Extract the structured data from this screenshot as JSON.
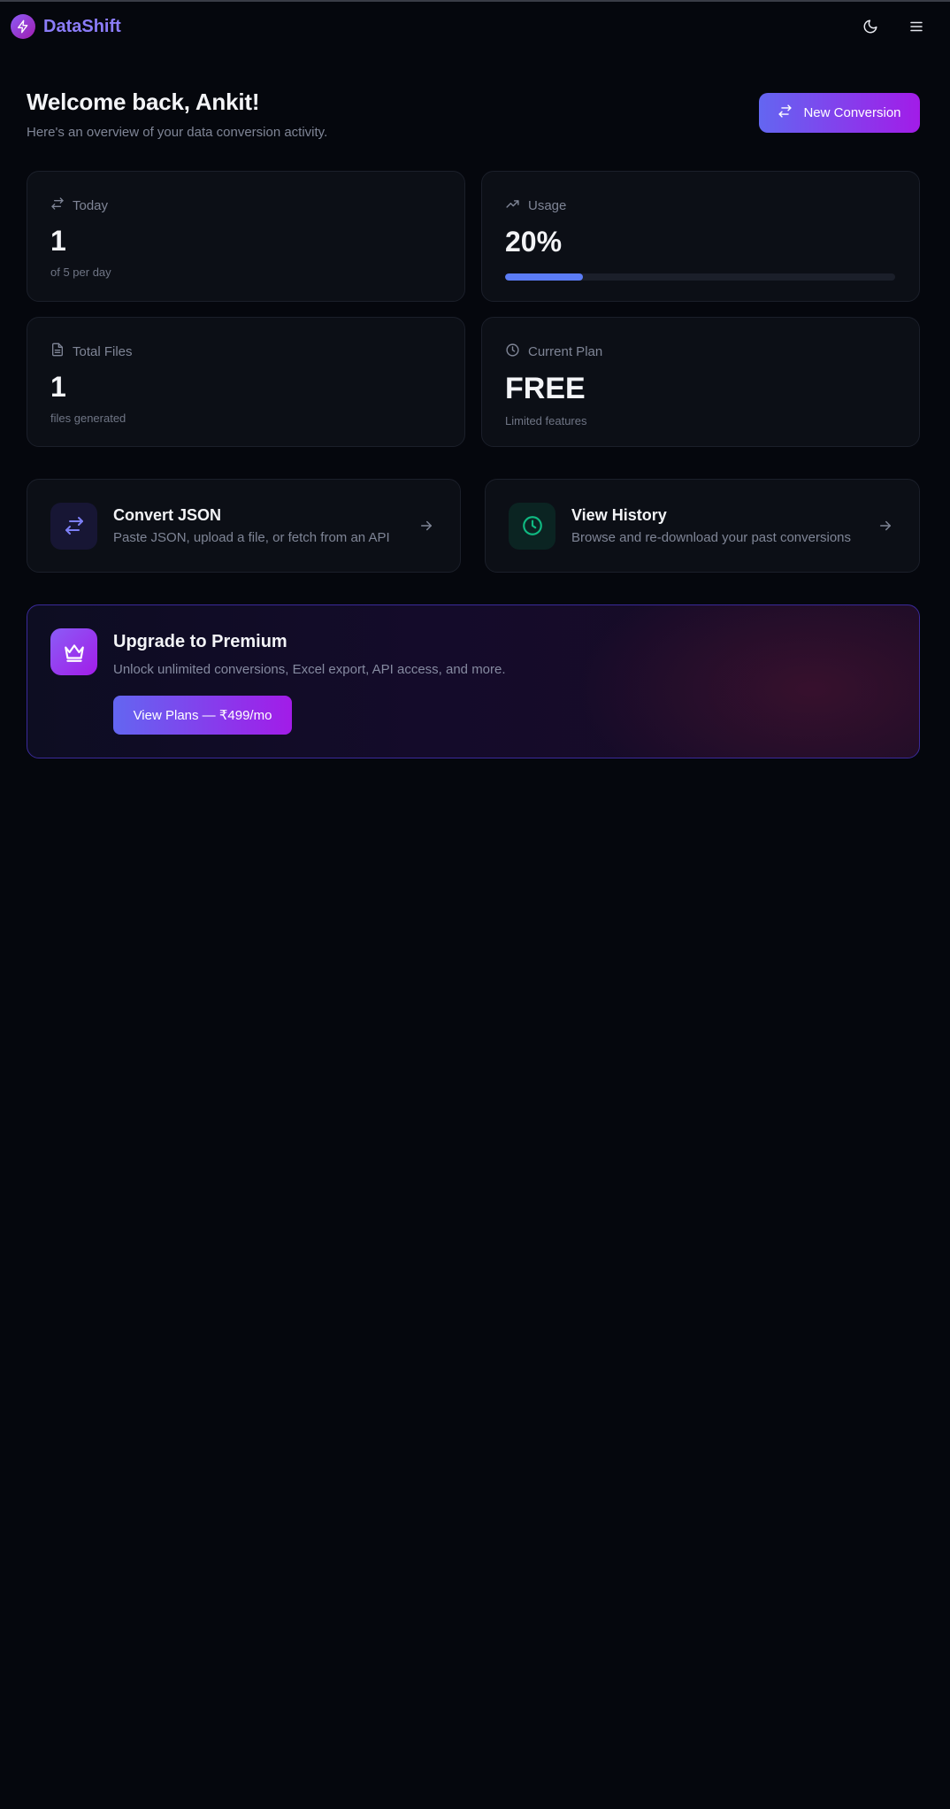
{
  "app": {
    "brand": "DataShift",
    "accent": "#6366f1",
    "accent_secondary": "#a21ce8"
  },
  "header": {
    "logo_icon": "bolt-icon",
    "theme_toggle_icon": "moon-icon",
    "menu_icon": "hamburger-menu-icon"
  },
  "welcome": {
    "title": "Welcome back, Ankit!",
    "subtitle": "Here's an overview of your data conversion activity."
  },
  "new_conversion": {
    "label": "New Conversion",
    "icon": "swap-arrows-icon"
  },
  "stats": {
    "today": {
      "label": "Today",
      "value": "1",
      "sub": "of 5 per day",
      "icon": "swap-arrows-icon"
    },
    "usage": {
      "label": "Usage",
      "value": "20%",
      "progress": 0.2,
      "icon": "trending-up-icon",
      "bar_color": "#5b7cf6"
    },
    "total_files": {
      "label": "Total Files",
      "value": "1",
      "sub": "files generated",
      "icon": "file-icon"
    },
    "plan": {
      "label": "Current Plan",
      "value": "FREE",
      "sub": "Limited features",
      "icon": "clock-icon"
    }
  },
  "actions": {
    "convert": {
      "title": "Convert JSON",
      "desc": "Paste JSON, upload a file, or fetch from an API",
      "icon": "swap-arrows-icon",
      "icon_color": "#6366f1"
    },
    "history": {
      "title": "View History",
      "desc": "Browse and re-download your past conversions",
      "icon": "clock-icon",
      "icon_color": "#10b981"
    }
  },
  "premium": {
    "title": "Upgrade to Premium",
    "desc": "Unlock unlimited conversions, Excel export, API access, and more.",
    "button": "View Plans — ₹499/mo",
    "icon": "crown-icon"
  }
}
